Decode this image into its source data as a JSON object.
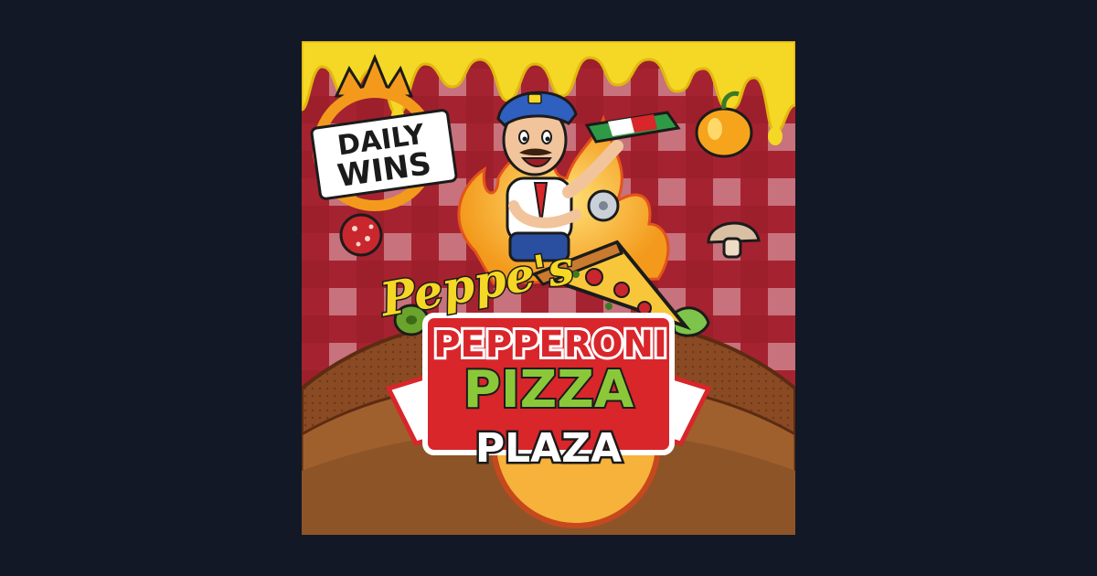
{
  "artwork": {
    "badge": {
      "line1": "DAILY",
      "line2": "WINS"
    },
    "title": {
      "script": "Peppe's",
      "line1": "PEPPERONI",
      "line2": "PIZZA",
      "line3": "PLAZA"
    }
  },
  "colors": {
    "page_background": "#121826",
    "tablecloth_red": "#b3202b",
    "cheese_yellow": "#f5d726",
    "crust_brown": "#8a4a23",
    "title_red": "#d8262b",
    "title_green": "#8ac83a",
    "badge_orange": "#f39a1c"
  },
  "icons": [
    "chef-character",
    "pizza-box",
    "pizza-slice",
    "mushroom",
    "pepperoni-slice",
    "bell-pepper",
    "olive",
    "crown"
  ]
}
